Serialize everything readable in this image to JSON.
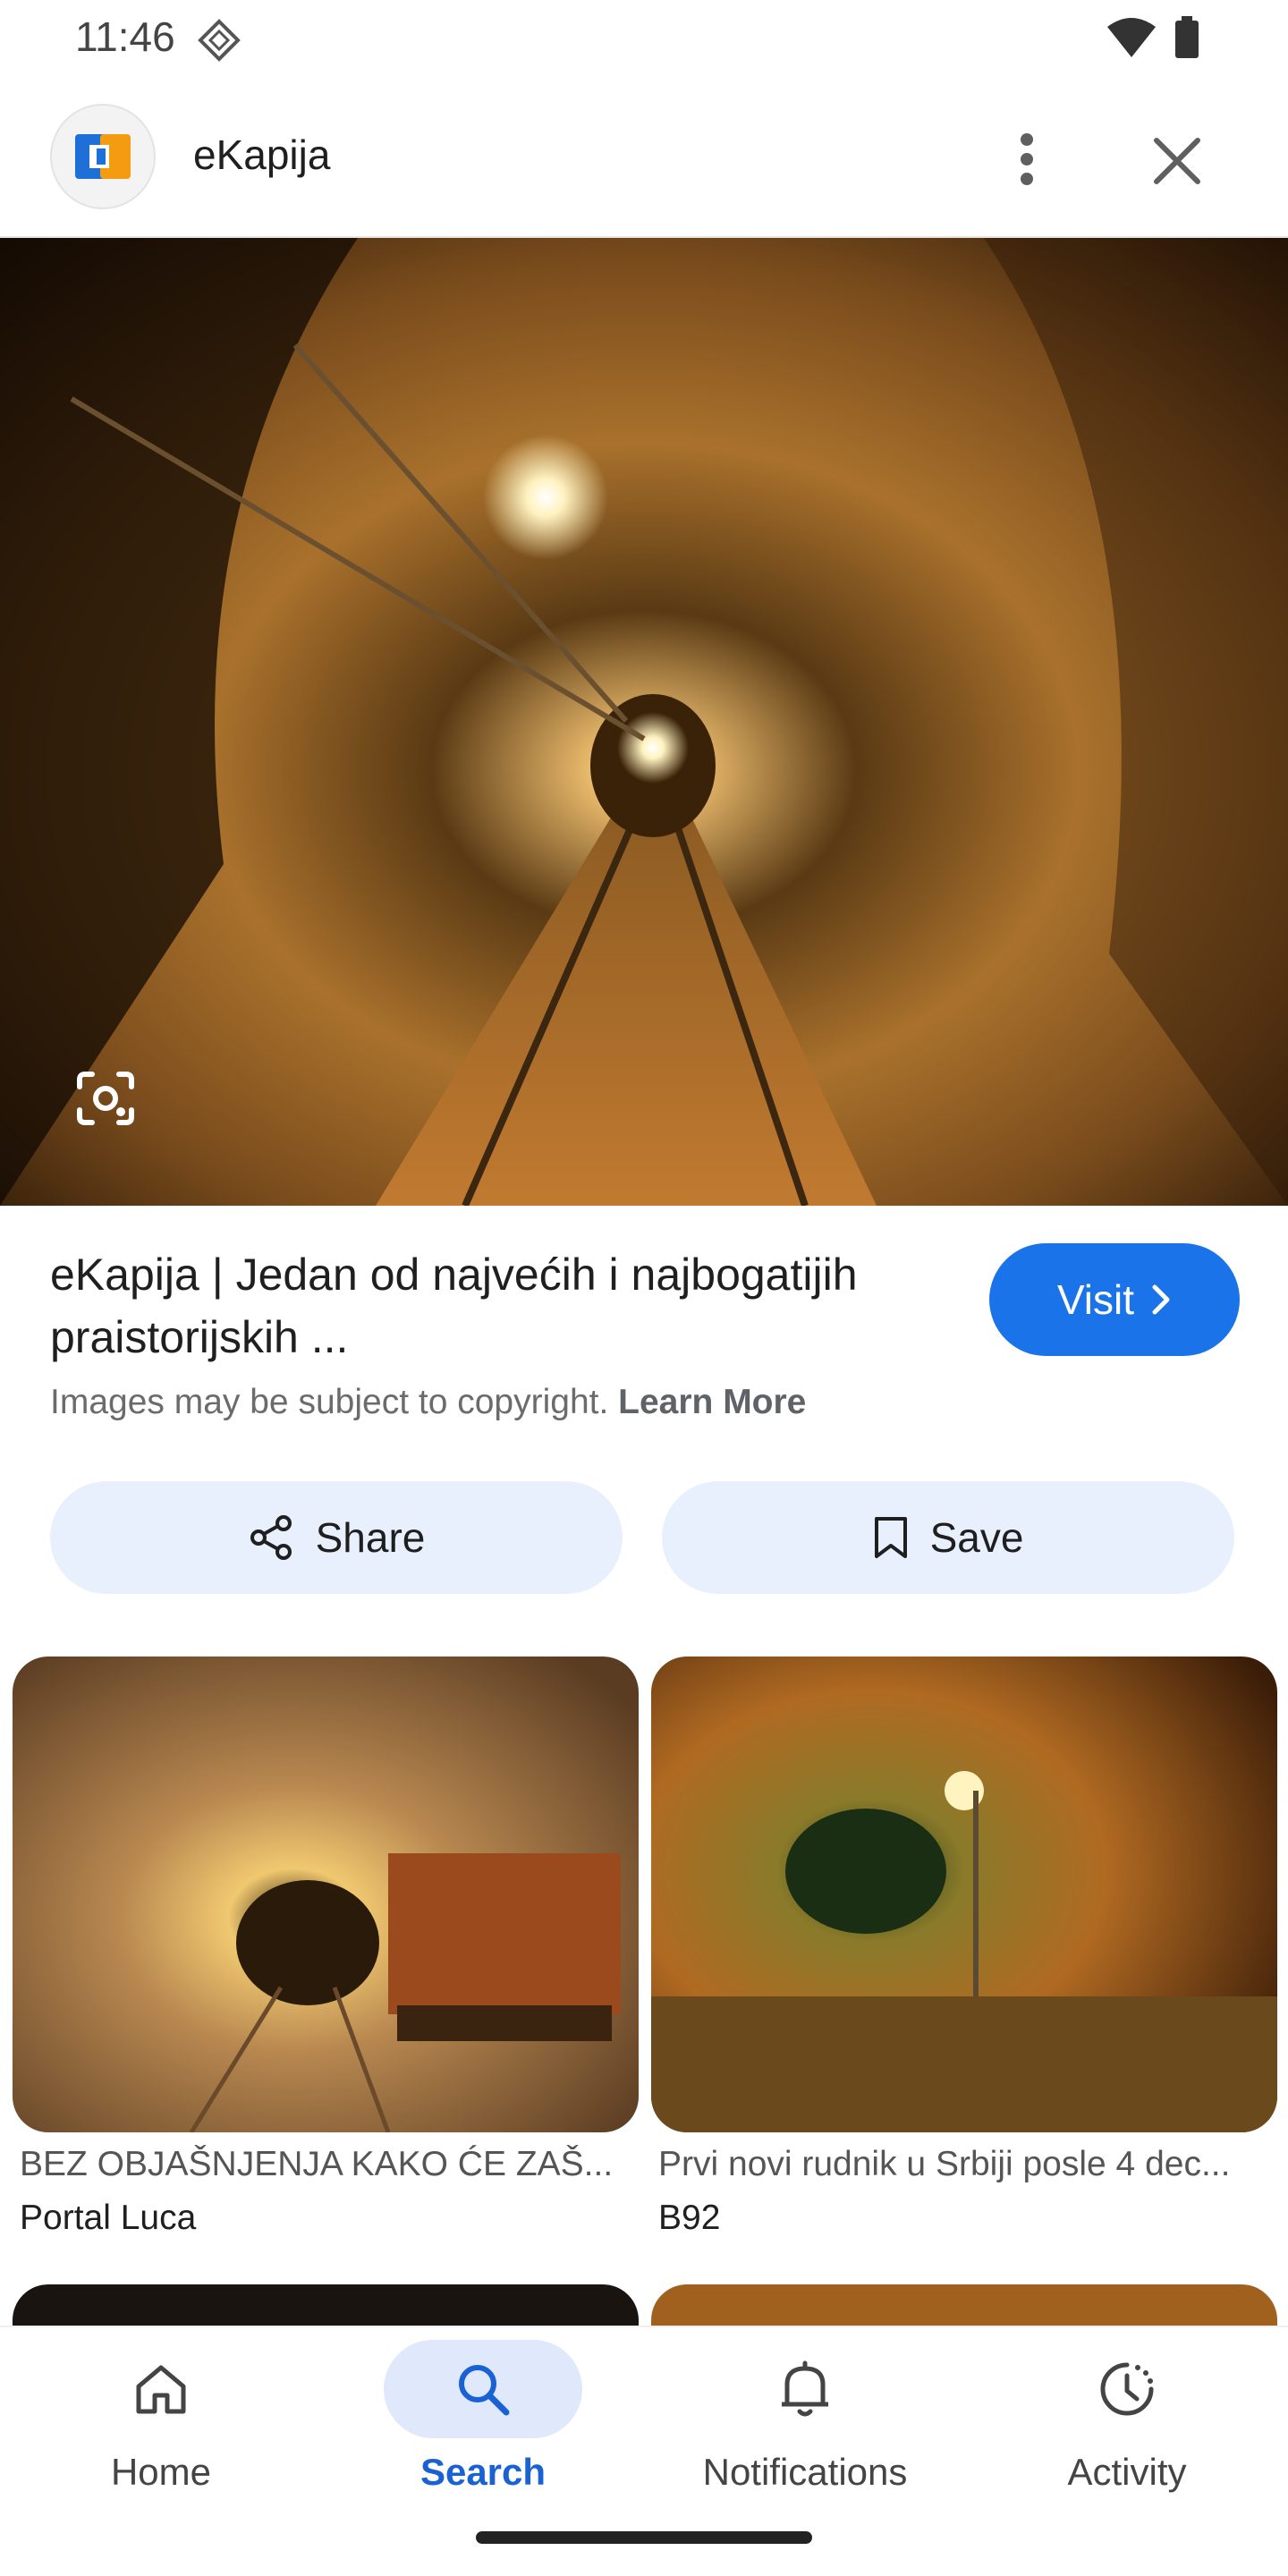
{
  "status_bar": {
    "time": "11:46"
  },
  "header": {
    "site_name": "eKapija"
  },
  "result": {
    "title": "eKapija | Jedan od najvećih i najbogatijih praistorijskih ...",
    "copyright_text": "Images may be subject to copyright.",
    "learn_more": "Learn More",
    "visit_label": "Visit"
  },
  "actions": {
    "share_label": "Share",
    "save_label": "Save"
  },
  "related": [
    {
      "caption": "BEZ OBJAŠNJENJA KAKO ĆE ZAŠ...",
      "source": "Portal Luca"
    },
    {
      "caption": "Prvi novi rudnik u Srbiji posle 4 dec...",
      "source": "B92"
    }
  ],
  "bottom_nav": [
    {
      "label": "Home",
      "icon": "home-icon",
      "active": false
    },
    {
      "label": "Search",
      "icon": "search-icon",
      "active": true
    },
    {
      "label": "Notifications",
      "icon": "bell-icon",
      "active": false
    },
    {
      "label": "Activity",
      "icon": "activity-icon",
      "active": false
    }
  ],
  "colors": {
    "accent": "#1a73e8",
    "chip_bg": "#e8f0fd",
    "active_nav": "#1a62d4"
  }
}
